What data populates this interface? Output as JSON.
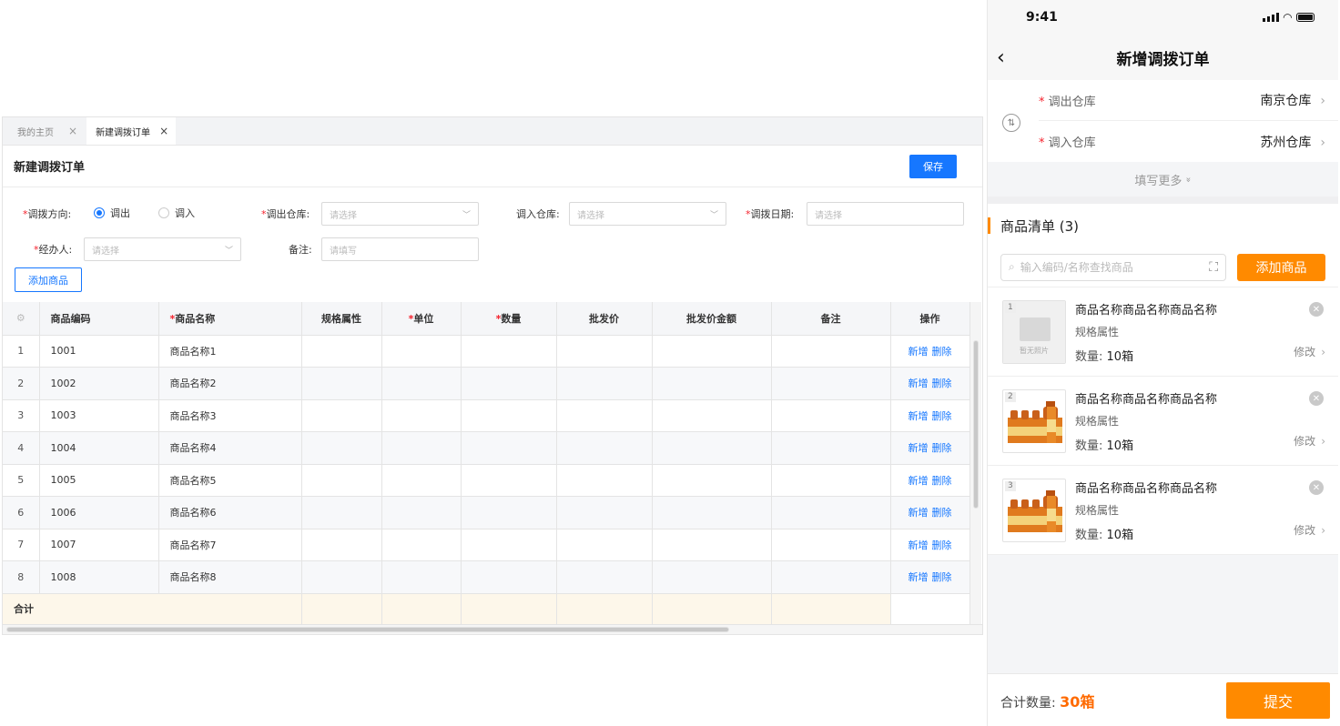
{
  "desktop": {
    "tabs": [
      {
        "label": "我的主页",
        "close": "×"
      },
      {
        "label": "新建调拨订单",
        "close": "×"
      }
    ],
    "page_title": "新建调拨订单",
    "save_label": "保存",
    "form": {
      "direction_label": "调拨方向:",
      "direction_options": [
        "调出",
        "调入"
      ],
      "out_wh_label": "调出仓库:",
      "in_wh_label": "调入仓库:",
      "date_label": "调拨日期:",
      "handler_label": "经办人:",
      "remark_label": "备注:",
      "select_placeholder": "请选择",
      "remark_placeholder": "请填写",
      "add_button": "添加商品",
      "required_mark": "*"
    },
    "table": {
      "headers": [
        "",
        "商品编码",
        "商品名称",
        "规格属性",
        "单位",
        "数量",
        "批发价",
        "批发价金额",
        "备注",
        "操作"
      ],
      "rows": [
        {
          "idx": "1",
          "code": "1001",
          "name": "商品名称1"
        },
        {
          "idx": "2",
          "code": "1002",
          "name": "商品名称2"
        },
        {
          "idx": "3",
          "code": "1003",
          "name": "商品名称3"
        },
        {
          "idx": "4",
          "code": "1004",
          "name": "商品名称4"
        },
        {
          "idx": "5",
          "code": "1005",
          "name": "商品名称5"
        },
        {
          "idx": "6",
          "code": "1006",
          "name": "商品名称6"
        },
        {
          "idx": "7",
          "code": "1007",
          "name": "商品名称7"
        },
        {
          "idx": "8",
          "code": "1008",
          "name": "商品名称8"
        }
      ],
      "op_add": "新增",
      "op_delete": "删除",
      "sum_label": "合计"
    }
  },
  "mobile": {
    "time": "9:41",
    "title": "新增调拨订单",
    "back": "‹",
    "out_wh_label": "调出仓库",
    "out_wh_value": "南京仓库",
    "in_wh_label": "调入仓库",
    "in_wh_value": "苏州仓库",
    "swap": "⇅",
    "more": "填写更多",
    "more_icon": "≫",
    "list_title": "商品清单 (3)",
    "search_placeholder": "输入编码/名称查找商品",
    "add_button": "添加商品",
    "no_photo": "暂无照片",
    "items": [
      {
        "num": "1",
        "name": "商品名称商品名称商品名称",
        "spec": "规格属性",
        "qty_label": "数量:",
        "qty": "10箱",
        "edit": "修改",
        "has_photo": false
      },
      {
        "num": "2",
        "name": "商品名称商品名称商品名称",
        "spec": "规格属性",
        "qty_label": "数量:",
        "qty": "10箱",
        "edit": "修改",
        "has_photo": true
      },
      {
        "num": "3",
        "name": "商品名称商品名称商品名称",
        "spec": "规格属性",
        "qty_label": "数量:",
        "qty": "10箱",
        "edit": "修改",
        "has_photo": true
      }
    ],
    "total_label": "合计数量:",
    "total_value": "30箱",
    "submit": "提交"
  },
  "colors": {
    "primary": "#1677ff",
    "accent": "#ff8a00",
    "required": "#f5222d"
  }
}
